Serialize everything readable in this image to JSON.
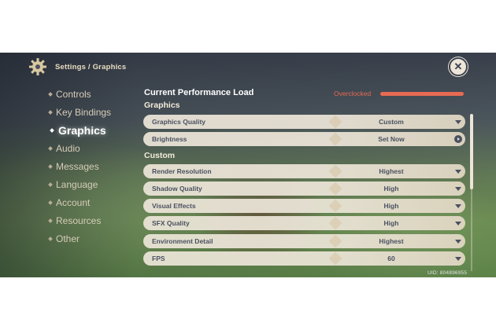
{
  "header": {
    "breadcrumb": "Settings / Graphics"
  },
  "nav": {
    "items": [
      {
        "label": "Controls"
      },
      {
        "label": "Key Bindings"
      },
      {
        "label": "Graphics"
      },
      {
        "label": "Audio"
      },
      {
        "label": "Messages"
      },
      {
        "label": "Language"
      },
      {
        "label": "Account"
      },
      {
        "label": "Resources"
      },
      {
        "label": "Other"
      }
    ],
    "active_index": 2
  },
  "performance": {
    "label": "Current Performance Load",
    "status": "Overclocked",
    "color": "#e86a52"
  },
  "sections": {
    "graphics": "Graphics",
    "custom": "Custom"
  },
  "settings": [
    {
      "label": "Graphics Quality",
      "value": "Custom"
    },
    {
      "label": "Brightness",
      "value": "Set Now"
    },
    {
      "label": "Render Resolution",
      "value": "Highest"
    },
    {
      "label": "Shadow Quality",
      "value": "High"
    },
    {
      "label": "Visual Effects",
      "value": "High"
    },
    {
      "label": "SFX Quality",
      "value": "High"
    },
    {
      "label": "Environment Detail",
      "value": "Highest"
    },
    {
      "label": "FPS",
      "value": "60"
    }
  ],
  "footer": {
    "uid": "UID: 804896955"
  },
  "icons": {
    "settings": "gear-icon",
    "close": "close-icon",
    "dropdown": "chevron-down-icon",
    "action": "play-circle-icon"
  },
  "colors": {
    "panel": "#ece5d8",
    "text_dark": "#4a5060",
    "accent_red": "#e86a52"
  }
}
